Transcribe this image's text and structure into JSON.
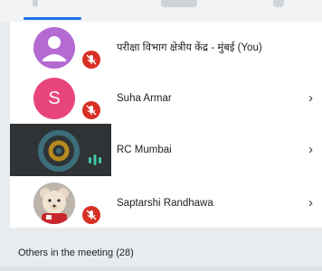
{
  "participants": [
    {
      "name": "परीक्षा विभाग क्षेत्रीय केंद्र - मुंबई (You)",
      "avatar": "person-icon",
      "muted": true,
      "chevron": ""
    },
    {
      "name": "Suha Armar",
      "avatar_letter": "S",
      "muted": true,
      "chevron": "›"
    },
    {
      "name": "RC Mumbai",
      "avatar": "video-feed",
      "speaking": true,
      "chevron": "›"
    },
    {
      "name": "Saptarshi Randhawa",
      "avatar": "teddy-bear-photo",
      "muted": true,
      "chevron": "›"
    }
  ],
  "others": {
    "title": "Others in the meeting (28)"
  },
  "colors": {
    "accent": "#1a73e8",
    "mic_muted": "#d93025",
    "speaking": "#3ec6a8"
  }
}
